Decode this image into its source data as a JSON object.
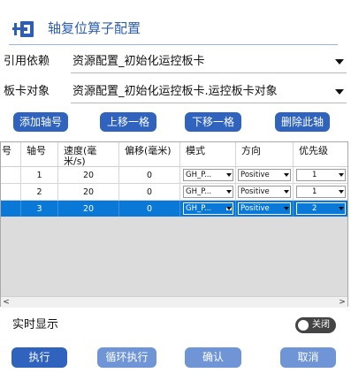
{
  "header": {
    "title": "轴复位算子配置"
  },
  "form": {
    "ref_label": "引用依赖",
    "ref_value": "资源配置_初始化运控板卡",
    "board_label": "板卡对象",
    "board_value": "资源配置_初始化运控板卡.运控板卡对象"
  },
  "toolbar": {
    "add": "添加轴号",
    "up": "上移一格",
    "down": "下移一格",
    "delete": "删除此轴"
  },
  "table": {
    "columns": [
      "号",
      "轴号",
      "速度(毫米/s)",
      "偏移(毫米)",
      "模式",
      "方向",
      "优先级"
    ],
    "rows": [
      {
        "axis": "1",
        "speed": "20",
        "offset": "0",
        "mode": "GH_P...",
        "direction": "Positive",
        "priority": "1",
        "selected": false
      },
      {
        "axis": "2",
        "speed": "20",
        "offset": "0",
        "mode": "GH_P...",
        "direction": "Positive",
        "priority": "1",
        "selected": false
      },
      {
        "axis": "3",
        "speed": "20",
        "offset": "0",
        "mode": "GH_P...",
        "direction": "Positive",
        "priority": "2",
        "selected": true
      }
    ],
    "scroll_left": "<",
    "scroll_right": ">"
  },
  "realtime": {
    "label": "实时显示",
    "toggle_text": "关闭",
    "on": false
  },
  "footer": {
    "execute": "执行",
    "loop": "循环执行",
    "confirm": "确认",
    "cancel": "取消"
  },
  "colors": {
    "accent": "#2f63bd",
    "selection": "#0a78d7",
    "accent_light": "#6f95d6"
  }
}
